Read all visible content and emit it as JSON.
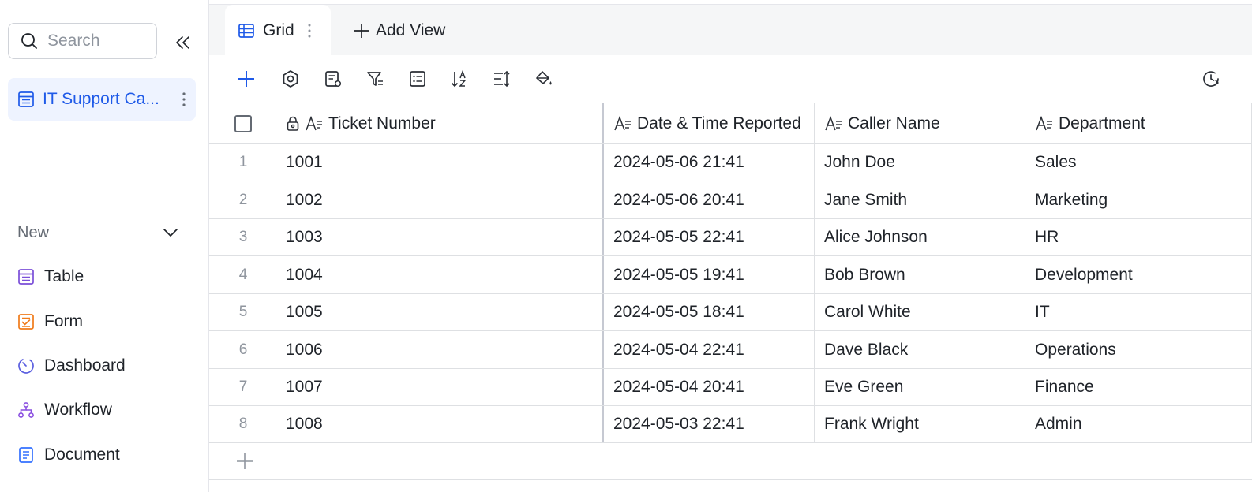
{
  "sidebar": {
    "search_placeholder": "Search",
    "tables": [
      {
        "label": "IT Support Ca...",
        "icon": "table-icon"
      }
    ],
    "new_label": "New",
    "create_items": [
      {
        "label": "Table",
        "icon": "table-icon",
        "color": "#7b4fd8"
      },
      {
        "label": "Form",
        "icon": "form-icon",
        "color": "#f07b1a"
      },
      {
        "label": "Dashboard",
        "icon": "dashboard-icon",
        "color": "#5b5fe0"
      },
      {
        "label": "Workflow",
        "icon": "workflow-icon",
        "color": "#8a4fe0"
      },
      {
        "label": "Document",
        "icon": "document-icon",
        "color": "#3370ff"
      }
    ]
  },
  "tabs": {
    "active_label": "Grid",
    "add_view_label": "Add View"
  },
  "toolbar": {
    "icons": [
      "add-icon",
      "settings-icon",
      "field-settings-icon",
      "filter-icon",
      "group-icon",
      "sort-icon",
      "row-height-icon",
      "fill-color-icon",
      "history-icon"
    ]
  },
  "grid": {
    "columns": [
      "Ticket Number",
      "Date & Time Reported",
      "Caller Name",
      "Department"
    ],
    "rows": [
      {
        "index": "1",
        "ticket": "1001",
        "datetime": "2024-05-06 21:41",
        "caller": "John Doe",
        "department": "Sales"
      },
      {
        "index": "2",
        "ticket": "1002",
        "datetime": "2024-05-06 20:41",
        "caller": "Jane Smith",
        "department": "Marketing"
      },
      {
        "index": "3",
        "ticket": "1003",
        "datetime": "2024-05-05 22:41",
        "caller": "Alice Johnson",
        "department": "HR"
      },
      {
        "index": "4",
        "ticket": "1004",
        "datetime": "2024-05-05 19:41",
        "caller": "Bob Brown",
        "department": "Development"
      },
      {
        "index": "5",
        "ticket": "1005",
        "datetime": "2024-05-05 18:41",
        "caller": "Carol White",
        "department": "IT"
      },
      {
        "index": "6",
        "ticket": "1006",
        "datetime": "2024-05-04 22:41",
        "caller": "Dave Black",
        "department": "Operations"
      },
      {
        "index": "7",
        "ticket": "1007",
        "datetime": "2024-05-04 20:41",
        "caller": "Eve Green",
        "department": "Finance"
      },
      {
        "index": "8",
        "ticket": "1008",
        "datetime": "2024-05-03 22:41",
        "caller": "Frank Wright",
        "department": "Admin"
      }
    ]
  },
  "colors": {
    "accent": "#1f5ae8",
    "selected_bg": "#eef3ff"
  }
}
